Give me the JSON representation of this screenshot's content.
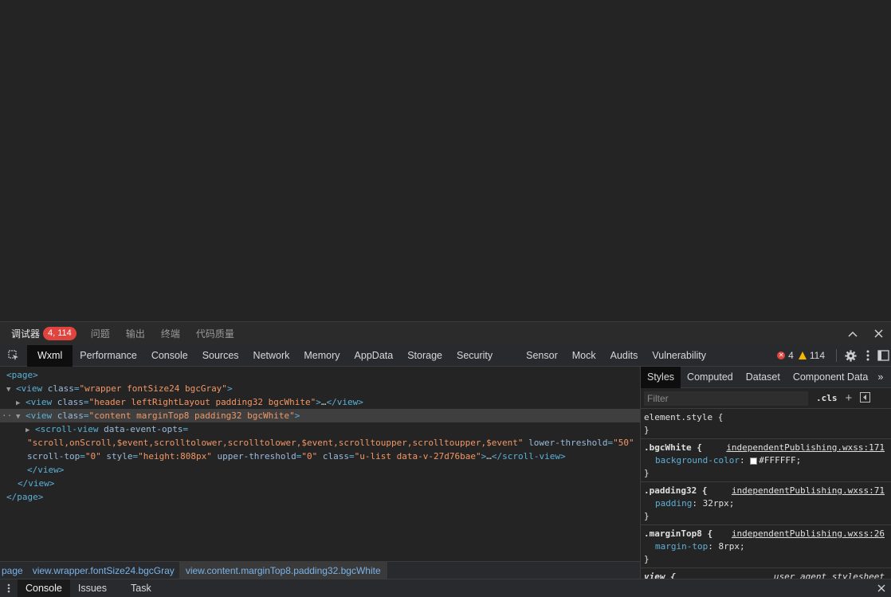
{
  "debugger_bar": {
    "tabs": [
      "调试器",
      "问题",
      "输出",
      "终端",
      "代码质量"
    ],
    "badge": "4, 114"
  },
  "devtools": {
    "tabs": [
      "Wxml",
      "Performance",
      "Console",
      "Sources",
      "Network",
      "Memory",
      "AppData",
      "Storage",
      "Security",
      "Sensor",
      "Mock",
      "Audits",
      "Vulnerability"
    ],
    "error_count": "4",
    "warning_count": "114"
  },
  "wxml_tree": {
    "page_open": "<page>",
    "wrapper_tag": "<view",
    "wrapper_attr": "class",
    "wrapper_val": "\"wrapper fontSize24 bgcGray\"",
    "header_attr": "class",
    "header_val": "\"header leftRightLayout padding32 bgcWhite\"",
    "header_ellipsis": "…",
    "header_close": "</view>",
    "content_attr": "class",
    "content_val": "\"content marginTop8 padding32 bgcWhite\"",
    "scroll_tag": "<scroll-view",
    "scroll_attr1": "data-event-opts",
    "scroll_val1": "\"scroll,onScroll,$event,scrolltolower,scrolltolower,$event,scrolltoupper,scrolltoupper,$event\"",
    "scroll_attr2": "lower-threshold",
    "scroll_val2": "\"50\"",
    "scroll_attr3": "scroll-top",
    "scroll_val3": "\"0\"",
    "scroll_attr4": "style",
    "scroll_val4": "\"height:808px\"",
    "scroll_attr5": "upper-threshold",
    "scroll_val5": "\"0\"",
    "scroll_attr6": "class",
    "scroll_val6": "\"u-list data-v-27d76bae\"",
    "scroll_close": "</scroll-view>",
    "view_close": "</view>",
    "page_close": "</page>"
  },
  "styles_panel": {
    "tabs": [
      "Styles",
      "Computed",
      "Dataset",
      "Component Data"
    ],
    "filter_placeholder": "Filter",
    "cls_label": ".cls",
    "rules": [
      {
        "selector": "element.style {",
        "source": "",
        "prop": "",
        "value": ""
      },
      {
        "selector": ".bgcWhite {",
        "source": "independentPublishing.wxss:171",
        "prop": "background-color",
        "value": "#FFFFFF;"
      },
      {
        "selector": ".padding32 {",
        "source": "independentPublishing.wxss:71",
        "prop": "padding",
        "value": "32rpx;"
      },
      {
        "selector": ".marginTop8 {",
        "source": "independentPublishing.wxss:26",
        "prop": "margin-top",
        "value": "8rpx;"
      },
      {
        "selector": "view {",
        "source": "user agent stylesheet",
        "prop": "",
        "value": ""
      }
    ],
    "close_brace": "}"
  },
  "breadcrumbs": [
    "page",
    "view.wrapper.fontSize24.bgcGray",
    "view.content.marginTop8.padding32.bgcWhite"
  ],
  "drawer_tabs": [
    "Console",
    "Issues",
    "Task"
  ],
  "colors": {
    "tag": "#5db0d7",
    "attr_value": "#f29766",
    "error": "#e0443e",
    "warning": "#f5b800"
  }
}
